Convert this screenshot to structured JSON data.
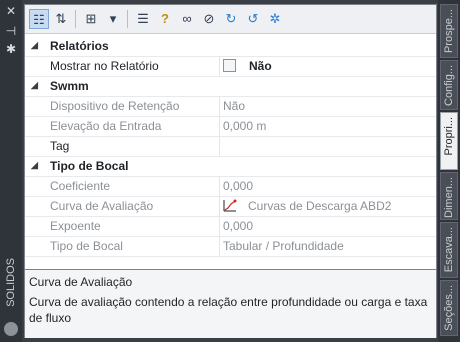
{
  "toolbar": {
    "buttons": [
      {
        "icon": "categorized-view-icon",
        "glyph": "☷"
      },
      {
        "icon": "sort-alpha-icon",
        "glyph": "⇅"
      },
      {
        "icon": "expand-all-icon",
        "glyph": "⊞"
      },
      {
        "icon": "filter-icon",
        "glyph": "▾"
      },
      {
        "icon": "properties-list-icon",
        "glyph": "☰"
      },
      {
        "icon": "help-icon",
        "glyph": "?"
      },
      {
        "icon": "binoculars-icon",
        "glyph": "∞"
      },
      {
        "icon": "link-icon",
        "glyph": "⊘"
      },
      {
        "icon": "refresh-icon",
        "glyph": "↻"
      },
      {
        "icon": "apply-icon",
        "glyph": "↺"
      },
      {
        "icon": "pin-icon",
        "glyph": "✲"
      }
    ]
  },
  "grid": {
    "relatorios": {
      "title": "Relatórios",
      "mostrar_label": "Mostrar no Relatório",
      "mostrar_value": "Não"
    },
    "swmm": {
      "title": "Swmm",
      "dispositivo_label": "Dispositivo de Retenção",
      "dispositivo_value": "Não",
      "elevacao_label": "Elevação da Entrada",
      "elevacao_value": "0,000 m",
      "tag_label": "Tag",
      "tag_value": ""
    },
    "tipo_bocal": {
      "title": "Tipo de Bocal",
      "coeficiente_label": "Coeficiente",
      "coeficiente_value": "0,000",
      "curva_label": "Curva de Avaliação",
      "curva_value": "Curvas de Descarga ABD2",
      "expoente_label": "Expoente",
      "expoente_value": "0,000",
      "tipo_label": "Tipo de Bocal",
      "tipo_value": "Tabular / Profundidade"
    }
  },
  "description": {
    "title": "Curva de Avaliação",
    "body": "Curva de avaliação contendo a relação entre profundidade ou carga e taxa de fluxo"
  },
  "left_panel": {
    "title": "SOLIDOS"
  },
  "right_tabs": [
    "Prospe...",
    "Config...",
    "Propri...",
    "Dimen...",
    "Escava...",
    "Seções..."
  ],
  "colors": {
    "accent": "#c7dcf2",
    "curve_icon_red": "#d9261c"
  }
}
